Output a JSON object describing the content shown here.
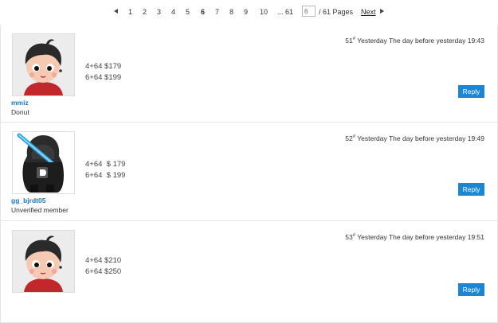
{
  "pagination": {
    "pages": [
      "1",
      "2",
      "3",
      "4",
      "5",
      "6",
      "7",
      "8",
      "9",
      "10",
      "... 61"
    ],
    "current": "6",
    "jump_value": "6",
    "total_text": "/ 61 Pages",
    "next_label": "Next"
  },
  "posts": [
    {
      "floor": "51",
      "floor_mark": "#",
      "time": "Yesterday The day before yesterday 19:43",
      "username": "mmiz",
      "role": "Donut",
      "lines": [
        "4+64 $179",
        "6+64 $199"
      ],
      "reply_label": "Reply"
    },
    {
      "floor": "52",
      "floor_mark": "#",
      "time": "Yesterday The day before yesterday 19:49",
      "username": "gg_bjrdt05",
      "role": "Unverified member",
      "lines": [
        "4+64  $ 179",
        "6+64  $ 199"
      ],
      "reply_label": "Reply"
    },
    {
      "floor": "53",
      "floor_mark": "#",
      "time": "Yesterday The day before yesterday 19:51",
      "username": "",
      "role": "",
      "lines": [
        "4+64 $210",
        "6+64 $250"
      ],
      "reply_label": "Reply"
    }
  ],
  "icons": {
    "prev": "chevron-left-icon",
    "next": "chevron-right-icon"
  },
  "colors": {
    "link": "#1a78c2",
    "reply_button": "#1a87d6"
  }
}
